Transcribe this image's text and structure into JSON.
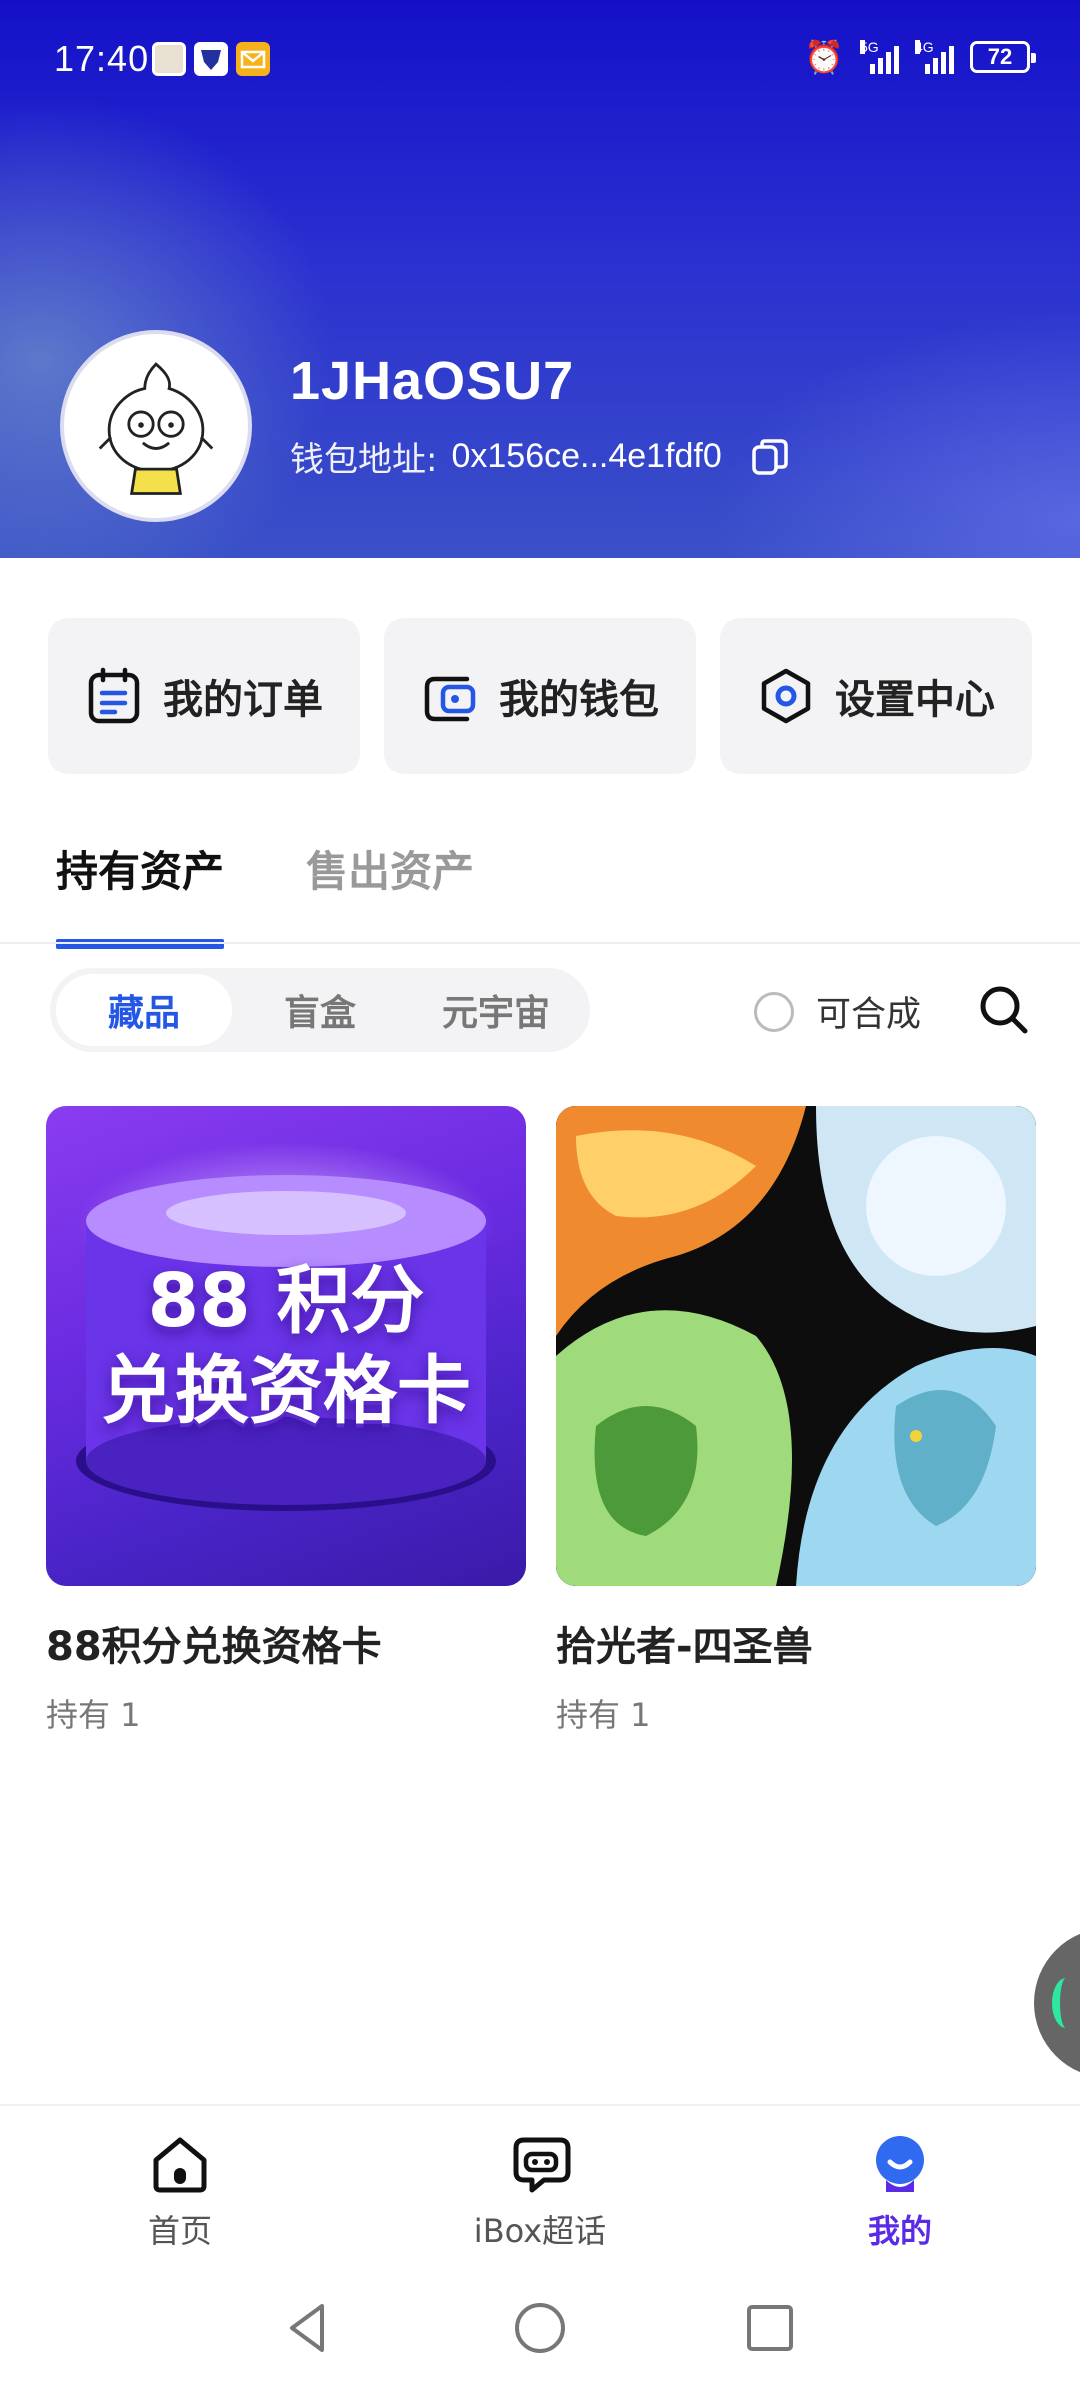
{
  "status_bar": {
    "time": "17:40",
    "battery": "72",
    "signal_1": "5G",
    "signal_2": "4G"
  },
  "profile": {
    "username": "1JHaOSU7",
    "wallet_label": "钱包地址:",
    "wallet_address": "0x156ce...4e1fdf0"
  },
  "quick_actions": [
    {
      "label": "我的订单",
      "icon": "orders-icon"
    },
    {
      "label": "我的钱包",
      "icon": "wallet-icon"
    },
    {
      "label": "设置中心",
      "icon": "settings-icon"
    }
  ],
  "asset_tabs": [
    {
      "label": "持有资产",
      "active": true
    },
    {
      "label": "售出资产",
      "active": false
    }
  ],
  "filter": {
    "segments": [
      {
        "label": "藏品",
        "active": true
      },
      {
        "label": "盲盒",
        "active": false
      },
      {
        "label": "元宇宙",
        "active": false
      }
    ],
    "composable_label": "可合成"
  },
  "items": [
    {
      "title": "88积分兑换资格卡",
      "count": "持有 1",
      "image_text_1": "88 积分",
      "image_text_2": "兑换资格卡"
    },
    {
      "title": "拾光者-四圣兽",
      "count": "持有 1"
    }
  ],
  "bottom_nav": [
    {
      "label": "首页",
      "icon": "home-icon",
      "active": false
    },
    {
      "label": "iBox超话",
      "icon": "chat-icon",
      "active": false
    },
    {
      "label": "我的",
      "icon": "profile-icon",
      "active": true
    }
  ],
  "colors": {
    "accent": "#2457e6",
    "nav_active": "#5a2be6"
  }
}
